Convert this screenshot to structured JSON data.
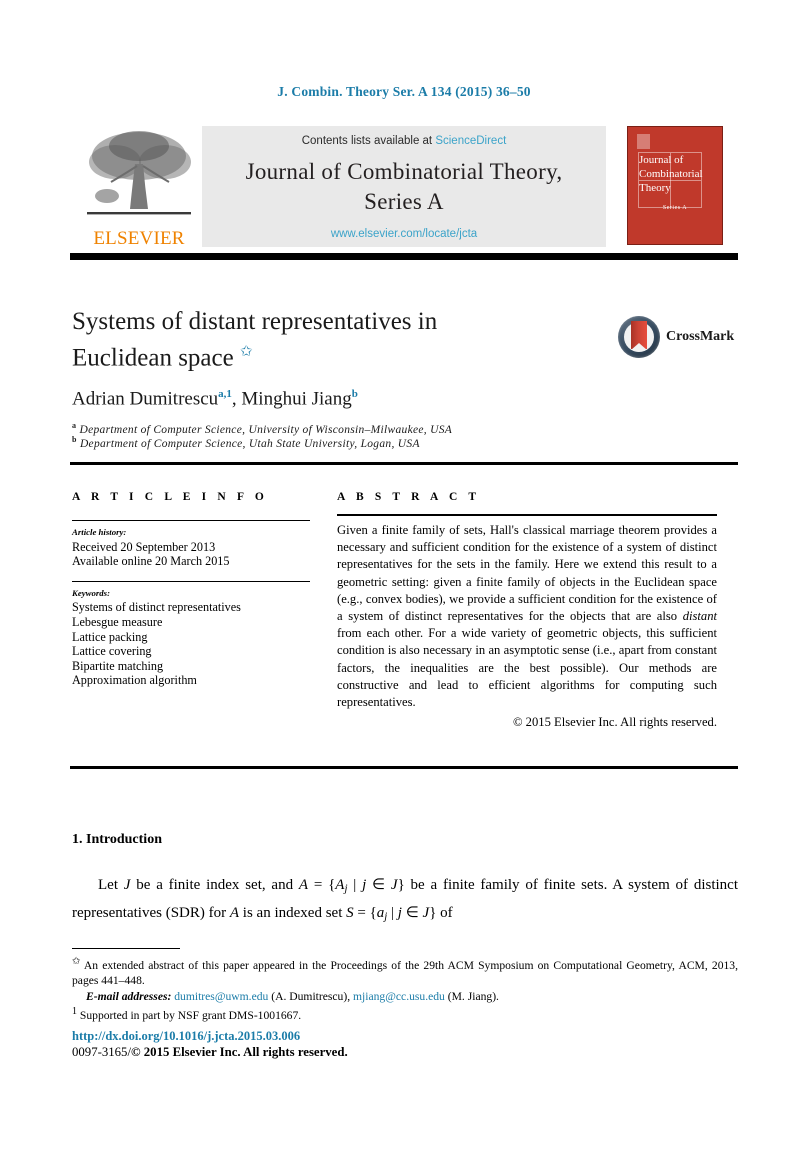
{
  "running_head": "J. Combin. Theory Ser. A 134 (2015) 36–50",
  "masthead": {
    "contents_prefix": "Contents lists available at ",
    "sciencedirect": "ScienceDirect",
    "journal_title_line1": "Journal of Combinatorial Theory,",
    "journal_title_line2": "Series A",
    "journal_url": "www.elsevier.com/locate/jcta",
    "publisher_wordmark": "ELSEVIER",
    "cover": {
      "title": "Journal of Combinatorial Theory",
      "series": "Series A"
    }
  },
  "article": {
    "title": "Systems of distant representatives in Euclidean space",
    "title_footnote_mark": "✩",
    "crossmark_label": "CrossMark",
    "authors": "Adrian Dumitrescu, Minghui Jiang",
    "author1": "Adrian Dumitrescu",
    "author1_marks": "a,1",
    "author2": "Minghui Jiang",
    "author2_marks": "b",
    "affiliation_a_mark": "a",
    "affiliation_a": "Department of Computer Science, University of Wisconsin–Milwaukee, USA",
    "affiliation_b_mark": "b",
    "affiliation_b": "Department of Computer Science, Utah State University, Logan, USA"
  },
  "info": {
    "heading": "A R T I C L E   I N F O",
    "history_label": "Article history:",
    "received": "Received 20 September 2013",
    "available_online": "Available online 20 March 2015",
    "keywords_label": "Keywords:",
    "keywords": [
      "Systems of distinct representatives",
      "Lebesgue measure",
      "Lattice packing",
      "Lattice covering",
      "Bipartite matching",
      "Approximation algorithm"
    ]
  },
  "abstract": {
    "heading": "A B S T R A C T",
    "part1": "Given a finite family of sets, Hall's classical marriage theorem provides a necessary and sufficient condition for the existence of a system of distinct representatives for the sets in the family. Here we extend this result to a geometric setting: given a finite family of objects in the Euclidean space (e.g., convex bodies), we provide a sufficient condition for the existence of a system of distinct representatives for the objects that are also ",
    "emphasis": "distant",
    "part2": " from each other. For a wide variety of geometric objects, this sufficient condition is also necessary in an asymptotic sense (i.e., apart from constant factors, the inequalities are the best possible). Our methods are constructive and lead to efficient algorithms for computing such representatives.",
    "copyright": "© 2015 Elsevier Inc. All rights reserved."
  },
  "body": {
    "section_number_title": "1.  Introduction",
    "paragraph_plain": "Let J be a finite index set, and A = {Aj | j ∈ J} be a finite family of finite sets. A system of distinct representatives (SDR) for A is an indexed set S = {aj | j ∈ J} of"
  },
  "footnotes": {
    "star_mark": "✩",
    "star_text": "An extended abstract of this paper appeared in the Proceedings of the 29th ACM Symposium on Computational Geometry, ACM, 2013, pages 441–448.",
    "email_label": "E-mail addresses:",
    "email1": "dumitres@uwm.edu",
    "email1_owner": "(A. Dumitrescu),",
    "email2": "mjiang@cc.usu.edu",
    "email2_owner": "(M. Jiang).",
    "one_mark": "1",
    "one_text": "Supported in part by NSF grant DMS-1001667."
  },
  "footer": {
    "doi": "http://dx.doi.org/10.1016/j.jcta.2015.03.006",
    "issn_line_plain": "0097-3165/",
    "issn_copyright": "© 2015 Elsevier Inc.",
    "issn_rights": " All rights reserved."
  },
  "colors": {
    "link": "#1b7ca8",
    "sciencedirect": "#3ba3c9",
    "elsevier_orange": "#ef8200",
    "cover_red": "#c0392b",
    "band_gray": "#e9e9e9"
  }
}
